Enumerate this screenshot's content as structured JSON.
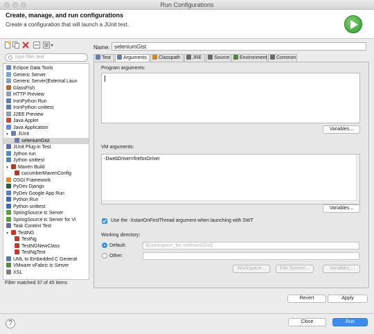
{
  "window": {
    "title": "Run Configurations"
  },
  "header": {
    "title": "Create, manage, and run configurations",
    "subtitle": "Create a configuration that will launch a JUnit test."
  },
  "filter": {
    "placeholder": "type filter text"
  },
  "tree": [
    {
      "label": "Eclipse Data Tools",
      "icon": "database-icon",
      "color": "#6b8cc2"
    },
    {
      "label": "Generic Server",
      "icon": "server-icon",
      "color": "#7aa3cf"
    },
    {
      "label": "Generic Server(External Laun",
      "icon": "server-icon",
      "color": "#7aa3cf"
    },
    {
      "label": "GlassFish",
      "icon": "glassfish-icon",
      "color": "#b46a2a"
    },
    {
      "label": "HTTP Preview",
      "icon": "http-icon",
      "color": "#8aa1b8"
    },
    {
      "label": "IronPython Run",
      "icon": "python-icon",
      "color": "#5a7fb5"
    },
    {
      "label": "IronPython unittest",
      "icon": "python-icon",
      "color": "#5a7fb5"
    },
    {
      "label": "J2EE Preview",
      "icon": "j2ee-icon",
      "color": "#8aa1b8"
    },
    {
      "label": "Java Applet",
      "icon": "applet-icon",
      "color": "#c94a3a"
    },
    {
      "label": "Java Application",
      "icon": "java-app-icon",
      "color": "#5b8ed6"
    },
    {
      "label": "JUnit",
      "icon": "junit-icon",
      "color": "#6b7fae",
      "expanded": true
    },
    {
      "label": "seleniumGist",
      "icon": "junit-icon",
      "color": "#6b7fae",
      "child": true,
      "selected": true
    },
    {
      "label": "JUnit Plug-in Test",
      "icon": "plugin-test-icon",
      "color": "#5c6fb0"
    },
    {
      "label": "Jython run",
      "icon": "jython-icon",
      "color": "#4b8ac7"
    },
    {
      "label": "Jython unittest",
      "icon": "jython-icon",
      "color": "#4b8ac7"
    },
    {
      "label": "Maven Build",
      "icon": "maven-icon",
      "color": "#b23a2a",
      "expanded": true
    },
    {
      "label": "cucumberMavenConfig",
      "icon": "maven-icon",
      "color": "#b23a2a",
      "child": true
    },
    {
      "label": "OSGi Framework",
      "icon": "osgi-icon",
      "color": "#e08b2a"
    },
    {
      "label": "PyDev Django",
      "icon": "django-icon",
      "color": "#2b5d3f"
    },
    {
      "label": "PyDev Google App Run",
      "icon": "pydev-icon",
      "color": "#4f86c6"
    },
    {
      "label": "Python Run",
      "icon": "python-icon",
      "color": "#3d6fb0"
    },
    {
      "label": "Python unittest",
      "icon": "python-icon",
      "color": "#3d6fb0"
    },
    {
      "label": "SpringSource tc Server",
      "icon": "spring-icon",
      "color": "#5aa03a"
    },
    {
      "label": "SpringSource tc Server for Vi",
      "icon": "spring-icon",
      "color": "#5aa03a"
    },
    {
      "label": "Task Context Test",
      "icon": "task-icon",
      "color": "#6a6a9e"
    },
    {
      "label": "TestNG",
      "icon": "testng-icon",
      "color": "#c0392b",
      "expanded": true
    },
    {
      "label": "TestNg",
      "icon": "testng-icon",
      "color": "#c0392b",
      "child": true
    },
    {
      "label": "TestNGNewClass",
      "icon": "testng-icon",
      "color": "#c0392b",
      "child": true
    },
    {
      "label": "TestNgTest",
      "icon": "testng-icon",
      "color": "#c0392b",
      "child": true
    },
    {
      "label": "UML to Embedded C Generat",
      "icon": "uml-icon",
      "color": "#5a79a8"
    },
    {
      "label": "VMware vFabric tc Server",
      "icon": "vmware-icon",
      "color": "#4f8f3a"
    },
    {
      "label": "XSL",
      "icon": "xsl-icon",
      "color": "#7f7f7f"
    }
  ],
  "filter_status": "Filter matched 37 of 45 items",
  "name": {
    "label": "Name:",
    "value": "seleniumGist"
  },
  "tabs": [
    {
      "label": "Test",
      "icon": "test-icon",
      "color": "#6b7fae"
    },
    {
      "label": "Arguments",
      "icon": "arguments-icon",
      "color": "#5a7db3",
      "active": true
    },
    {
      "label": "Classpath",
      "icon": "classpath-icon",
      "color": "#c98a2a"
    },
    {
      "label": "JRE",
      "icon": "jre-icon",
      "color": "#6a6a6a"
    },
    {
      "label": "Source",
      "icon": "source-icon",
      "color": "#6a6a6a"
    },
    {
      "label": "Environment",
      "icon": "environment-icon",
      "color": "#4a8a3a"
    },
    {
      "label": "Common",
      "icon": "common-icon",
      "color": "#6a6a6a"
    }
  ],
  "arguments": {
    "program_label": "Program arguments:",
    "program_value": "",
    "variables_label": "Variables...",
    "vm_label": "VM arguments:",
    "vm_value": "-DwebDriver=firefoxDriver",
    "vm_variables_label": "Variables...",
    "xstart_label": "Use the -XstartOnFirstThread argument when launching with SWT",
    "xstart_checked": true
  },
  "working_directory": {
    "label": "Working directory:",
    "default_label": "Default:",
    "default_value": "${workspace_loc:seleniumGist}",
    "other_label": "Other:",
    "other_value": "",
    "workspace_label": "Workspace...",
    "filesystem_label": "File System...",
    "variables_label": "Variables...",
    "selected": "default"
  },
  "actions": {
    "revert": "Revert",
    "apply": "Apply"
  },
  "footer": {
    "help": "?",
    "close": "Close",
    "run": "Run"
  },
  "colors": {
    "accent": "#3b8ef0",
    "run_green": "#2e9a2b"
  }
}
